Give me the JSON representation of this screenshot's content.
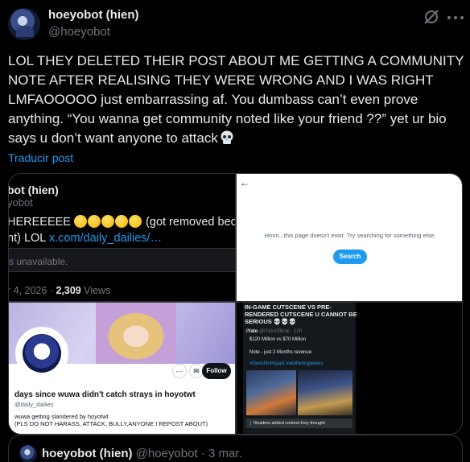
{
  "author": {
    "name": "hoeyobot (hien)",
    "handle": "@hoeyobot"
  },
  "tweet": {
    "text": "LOL THEY DELETED THEIR POST ABOUT ME GETTING A COMMUNITY NOTE AFTER REALISING THEY WERE WRONG AND I WAS RIGHT LMFAOOOOO just embarrassing af. You dumbass can’t even prove anything. “You wanna get community noted like your friend ??” yet ur bio says u don’t want anyone to attack",
    "translate_label": "Traducir post"
  },
  "icons": {
    "grok": "grok-slash-icon",
    "more": "more-dots-icon",
    "skull": "skull-icon",
    "thinking": "thinking-face-icon"
  },
  "media": {
    "screenshot1": {
      "name": "bot (hien)",
      "handle": "yobot",
      "text_start": "HEREEEEE",
      "text_end": "(got removed because I w",
      "line2_start": "nt) LOL ",
      "link": "x.com/daily_dailies/…",
      "unavailable": "s unavailable.",
      "date": "r 4, 2026 · ",
      "views_count": "2,309",
      "views_label": " Views"
    },
    "screenshot2": {
      "back": "←",
      "message": "Hmm...this page doesn't exist. Try searching for something else.",
      "search_label": "Search"
    },
    "screenshot3": {
      "dots": "···",
      "mail": "✉",
      "follow_label": "Follow",
      "profile_name": "days since wuwa didn't catch strays in hoyotwt",
      "profile_handle": "@daily_dailies",
      "bio_line1": "wuwa getting slandered by hoyotwt",
      "bio_line2": "(PLS DO NOT HARASS, ATTACK, BULLY,ANYONE I REPOST ABOUT)"
    },
    "screenshot4": {
      "caption": "IN-GAME CUTSCENE VS PRE-RENDERED CUTSCENE U CANNOT BE SERIOUS 💀💀💀",
      "inner_name": "iYato",
      "inner_meta": " @iYatoOfficial · 12h",
      "revenue": "$120 Million vs $70 Million",
      "note": "Note - just 2 Months revenue",
      "hashtags": "#GenshinImpact #wutheringwaves",
      "readers_prefix": "❙ ",
      "readers_text": "Readers added context they thought"
    }
  },
  "quoted": {
    "name": "hoeyobot (hien)",
    "handle": "@hoeyobot",
    "date": " · 3 mar."
  },
  "colors": {
    "background": "#000000",
    "link": "#1d9bf0",
    "muted": "#71767b",
    "text": "#e7e9ea"
  }
}
